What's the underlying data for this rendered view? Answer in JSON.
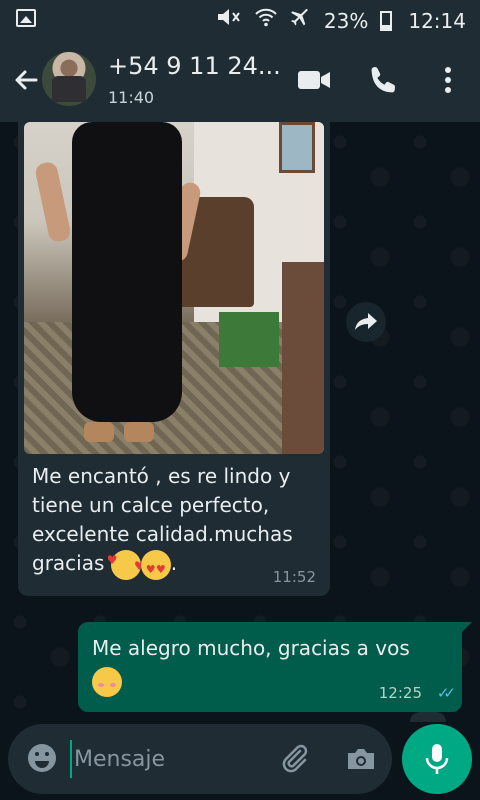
{
  "status_bar": {
    "battery": "23%",
    "time": "12:14",
    "icons": [
      "image-icon",
      "mute-icon",
      "wifi-icon",
      "airplane-icon",
      "battery-icon"
    ]
  },
  "header": {
    "contact_name": "+54 9 11 24...",
    "last_seen": "11:40",
    "icons": [
      "back-arrow-icon",
      "avatar",
      "video-call-icon",
      "voice-call-icon",
      "more-options-icon"
    ]
  },
  "messages": [
    {
      "direction": "incoming",
      "has_photo": true,
      "text": "Me encantó , es re lindo y tiene un calce perfecto, excelente calidad.muchas gracias",
      "emojis": [
        "smiling-face-with-hearts",
        "heart-eyes"
      ],
      "trailing": ".",
      "time": "11:52"
    },
    {
      "direction": "outgoing",
      "text": "Me alegro mucho, gracias a vos",
      "emojis": [
        "smiling-face-blush"
      ],
      "time": "12:25",
      "status": "read"
    }
  ],
  "composer": {
    "placeholder": "Mensaje",
    "icons": [
      "emoji-icon",
      "attach-icon",
      "camera-icon",
      "mic-icon"
    ]
  },
  "colors": {
    "header_bg": "#1f2c34",
    "chat_bg": "#0b141a",
    "incoming_bubble": "#1f2c34",
    "outgoing_bubble": "#005c4b",
    "accent": "#00a884",
    "read_ticks": "#53bdeb"
  }
}
